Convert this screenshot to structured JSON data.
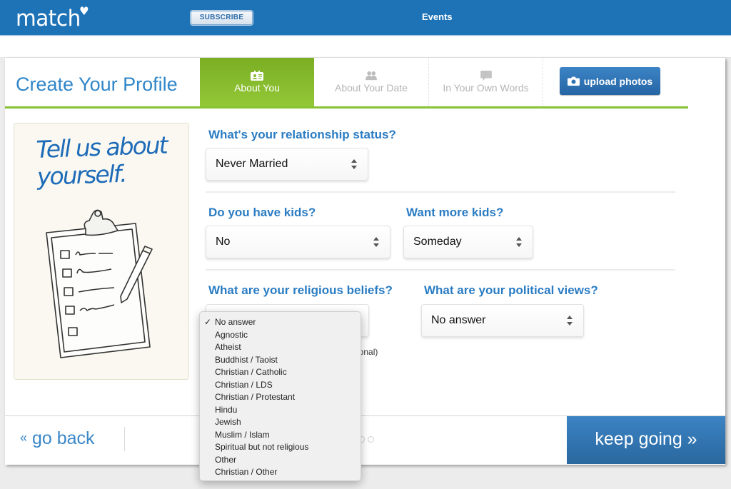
{
  "topbar": {
    "logo": "match",
    "subscribe_label": "SUBSCRIBE",
    "nav_events": "Events",
    "brand_color": "#1e73b7"
  },
  "header": {
    "title": "Create Your Profile",
    "tabs": [
      {
        "label": "About You",
        "icon": "profile-card-icon",
        "active": true
      },
      {
        "label": "About Your Date",
        "icon": "people-icon",
        "active": false
      },
      {
        "label": "In Your Own Words",
        "icon": "speech-bubble-icon",
        "active": false
      }
    ],
    "upload_label": "upload photos",
    "accent_color": "#86c232"
  },
  "illustration": {
    "line1": "Tell us about",
    "line2": "yourself."
  },
  "form": {
    "relationship": {
      "question": "What's your relationship status?",
      "value": "Never Married"
    },
    "have_kids": {
      "question": "Do you have kids?",
      "value": "No"
    },
    "want_kids": {
      "question": "Want more kids?",
      "value": "Someday"
    },
    "religion": {
      "question": "What are your religious beliefs?",
      "selected": "No answer",
      "options": [
        "No answer",
        "Agnostic",
        "Atheist",
        "Buddhist / Taoist",
        "Christian / Catholic",
        "Christian / LDS",
        "Christian / Protestant",
        "Hindu",
        "Jewish",
        "Muslim / Islam",
        "Spiritual but not religious",
        "Other",
        "Christian / Other"
      ]
    },
    "political": {
      "question": "What are your political views?",
      "value": "No answer"
    },
    "optional_note_visible": "ional)"
  },
  "footer": {
    "back_label": "go back",
    "back_glyph": "«",
    "next_label": "keep going »",
    "progress_dots_visible": 2
  }
}
